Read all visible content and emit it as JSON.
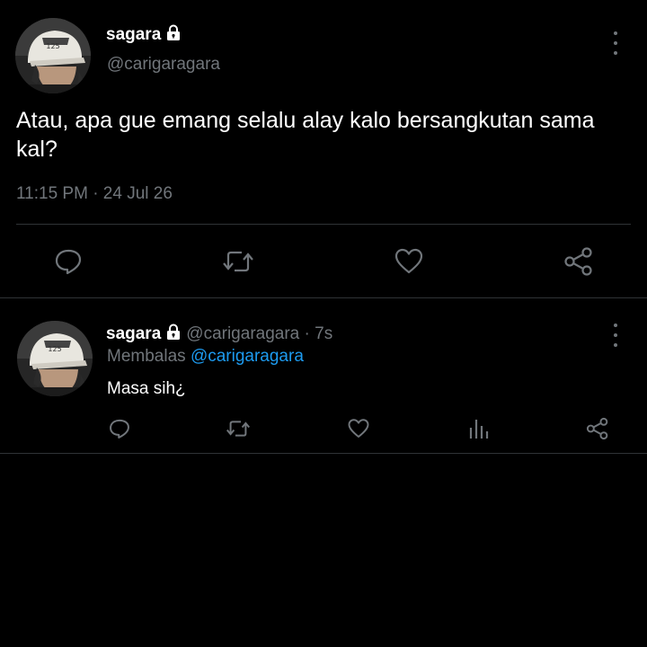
{
  "main_tweet": {
    "display_name": "sagara",
    "handle": "@carigaragara",
    "text": "Atau, apa gue emang selalu alay kalo bersangkutan sama kal?",
    "timestamp": "11:15 PM · 24 Jul 26",
    "icons": {
      "lock": "lock-icon",
      "more": "more-options-icon",
      "reply": "reply-icon",
      "retweet": "retweet-icon",
      "like": "like-icon",
      "share": "share-icon"
    }
  },
  "reply_tweet": {
    "display_name": "sagara",
    "handle_time": "@carigaragara · 7s",
    "replying_prefix": "Membalas",
    "replying_mention": "@carigaragara",
    "text": "Masa sih¿",
    "icons": {
      "reply": "reply-icon",
      "retweet": "retweet-icon",
      "like": "like-icon",
      "analytics": "analytics-icon",
      "share": "share-icon"
    }
  },
  "colors": {
    "background": "#000000",
    "primary_text": "#ffffff",
    "secondary_text": "#71767b",
    "accent": "#1d9bf0",
    "divider": "#2f3336"
  }
}
